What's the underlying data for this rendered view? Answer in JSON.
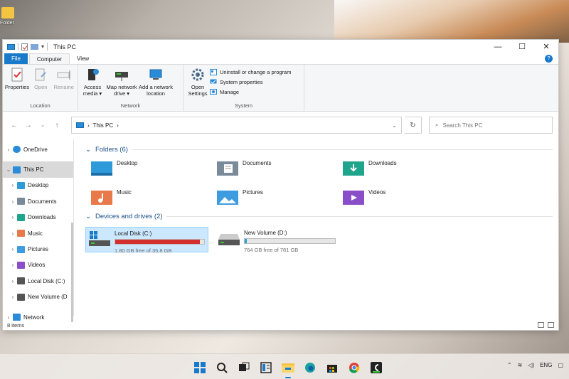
{
  "desktop": {
    "icon_label": "Folder"
  },
  "window": {
    "title": "This PC",
    "controls": {
      "minimize": "—",
      "maximize": "☐",
      "close": "✕"
    }
  },
  "ribbon": {
    "tabs": [
      "File",
      "Computer",
      "View"
    ],
    "help": "?",
    "groups": {
      "location": {
        "label": "Location",
        "properties": "Properties",
        "open": "Open",
        "rename": "Rename"
      },
      "network": {
        "label": "Network",
        "access_media": "Access media ▾",
        "map_drive": "Map network drive ▾",
        "add_location": "Add a network location"
      },
      "system": {
        "label": "System",
        "open_settings": "Open Settings",
        "uninstall": "Uninstall or change a program",
        "sys_props": "System properties",
        "manage": "Manage"
      }
    }
  },
  "address": {
    "breadcrumb": "This PC",
    "search_placeholder": "Search This PC"
  },
  "nav": {
    "items": [
      {
        "label": "OneDrive",
        "selected": false,
        "indent": 0
      },
      {
        "label": "This PC",
        "selected": true,
        "indent": 0
      },
      {
        "label": "Desktop",
        "selected": false,
        "indent": 1
      },
      {
        "label": "Documents",
        "selected": false,
        "indent": 1
      },
      {
        "label": "Downloads",
        "selected": false,
        "indent": 1
      },
      {
        "label": "Music",
        "selected": false,
        "indent": 1
      },
      {
        "label": "Pictures",
        "selected": false,
        "indent": 1
      },
      {
        "label": "Videos",
        "selected": false,
        "indent": 1
      },
      {
        "label": "Local Disk (C:)",
        "selected": false,
        "indent": 1
      },
      {
        "label": "New Volume (D",
        "selected": false,
        "indent": 1
      },
      {
        "label": "Network",
        "selected": false,
        "indent": 0
      }
    ]
  },
  "folders": {
    "header": "Folders (6)",
    "items": [
      "Desktop",
      "Documents",
      "Downloads",
      "Music",
      "Pictures",
      "Videos"
    ]
  },
  "drives": {
    "header": "Devices and drives (2)",
    "items": [
      {
        "name": "Local Disk (C:)",
        "free": "1.80 GB free of 35.8 GB",
        "used_fraction": 0.95,
        "bar_color": "#d32f2f",
        "selected": true
      },
      {
        "name": "New Volume (D:)",
        "free": "764 GB free of 781 GB",
        "used_fraction": 0.02,
        "bar_color": "#26a0da",
        "selected": false
      }
    ]
  },
  "status": {
    "items_count": "8 items"
  },
  "tray": {
    "lang": "ENG"
  },
  "colors": {
    "accent": "#1979ca",
    "selection": "#cce8ff"
  }
}
